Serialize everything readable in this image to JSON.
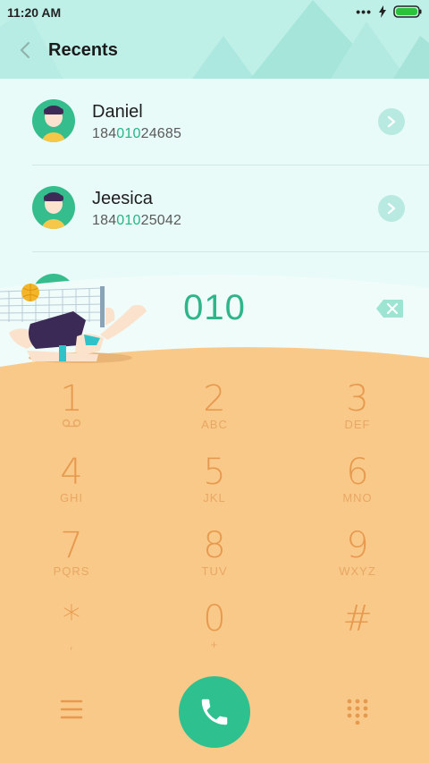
{
  "status_bar": {
    "time": "11:20 AM",
    "more": "•••"
  },
  "header": {
    "title": "Recents"
  },
  "recents": [
    {
      "name": "Daniel",
      "number_pre": "184",
      "number_hl": "010",
      "number_post": "24685"
    },
    {
      "name": "Jeesica",
      "number_pre": "184",
      "number_hl": "010",
      "number_post": "25042"
    }
  ],
  "dialer": {
    "input": "010",
    "keys": [
      {
        "num": "1",
        "letters": ""
      },
      {
        "num": "2",
        "letters": "ABC"
      },
      {
        "num": "3",
        "letters": "DEF"
      },
      {
        "num": "4",
        "letters": "GHI"
      },
      {
        "num": "5",
        "letters": "JKL"
      },
      {
        "num": "6",
        "letters": "MNO"
      },
      {
        "num": "7",
        "letters": "PQRS"
      },
      {
        "num": "8",
        "letters": "TUV"
      },
      {
        "num": "9",
        "letters": "WXYZ"
      },
      {
        "num": "*",
        "letters": ","
      },
      {
        "num": "0",
        "letters": "+"
      },
      {
        "num": "#",
        "letters": ""
      }
    ]
  },
  "colors": {
    "accent": "#2fc08f",
    "keypad_bg": "#f9c98a",
    "key_text": "#e79a4e",
    "header_bg": "#bff0e8"
  }
}
